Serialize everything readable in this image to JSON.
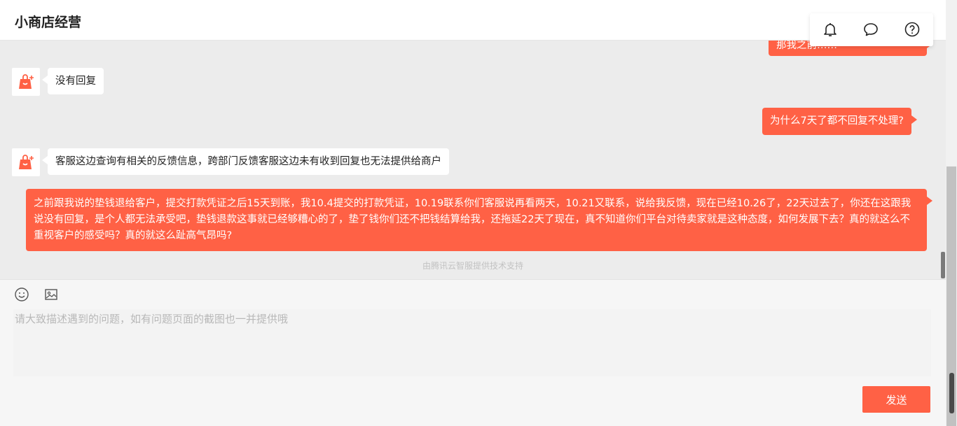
{
  "header": {
    "title": "小商店经营"
  },
  "top_icons": [
    "bell-icon",
    "chat-bubble-icon",
    "help-icon"
  ],
  "messages": [
    {
      "role": "user",
      "text": "那我之前……"
    },
    {
      "role": "bot",
      "text": "没有回复"
    },
    {
      "role": "user",
      "text": "为什么7天了都不回复不处理?"
    },
    {
      "role": "bot",
      "text": "客服这边查询有相关的反馈信息，跨部门反馈客服这边未有收到回复也无法提供给商户"
    },
    {
      "role": "user",
      "text": "之前跟我说的垫钱退给客户，提交打款凭证之后15天到账，我10.4提交的打款凭证，10.19联系你们客服说再看两天，10.21又联系，说给我反馈，现在已经10.26了，22天过去了，你还在这跟我说没有回复，是个人都无法承受吧，垫钱退款这事就已经够糟心的了，垫了钱你们还不把钱结算给我，还拖延22天了现在，真不知道你们平台对待卖家就是这种态度，如何发展下去？真的就这么不重视客户的感受吗？真的就这么趾高气昂吗?"
    }
  ],
  "powered_by": "由腾讯云智服提供技术支持",
  "input": {
    "placeholder": "请大致描述遇到的问题，如有问题页面的截图也一并提供哦",
    "value": ""
  },
  "send_label": "发送",
  "colors": {
    "accent": "#ff6145",
    "chat_bg": "#ececec"
  }
}
